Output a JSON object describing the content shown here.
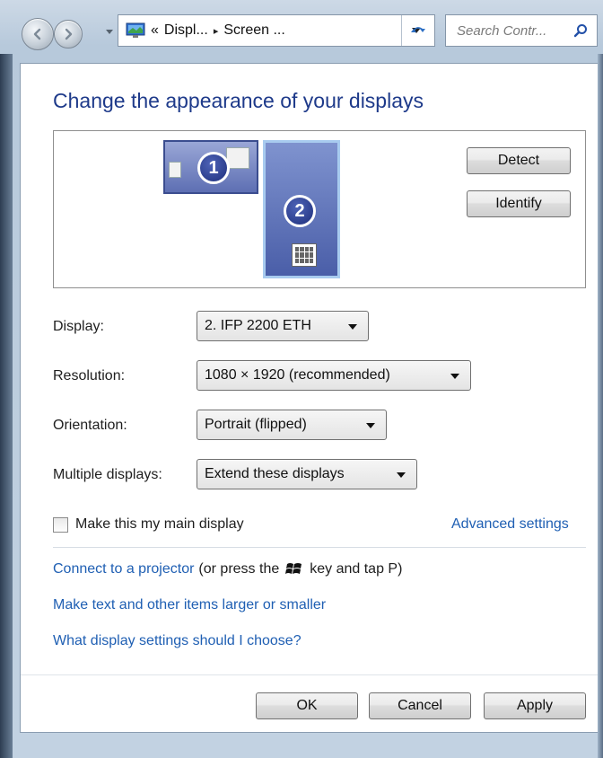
{
  "navbar": {
    "breadcrumb": {
      "prefix": "«",
      "part1": "Displ...",
      "separator": "▸",
      "part2": "Screen ..."
    },
    "search_placeholder": "Search Contr...",
    "icons": [
      "back-arrow-icon",
      "forward-arrow-icon",
      "history-dropdown-icon",
      "control-panel-icon",
      "refresh-icon",
      "search-icon"
    ]
  },
  "page": {
    "title": "Change the appearance of your displays"
  },
  "preview": {
    "monitor1_number": "1",
    "monitor2_number": "2",
    "detect_label": "Detect",
    "identify_label": "Identify"
  },
  "settings": {
    "display": {
      "label": "Display:",
      "value": "2. IFP 2200 ETH"
    },
    "resolution": {
      "label": "Resolution:",
      "value": "1080 × 1920 (recommended)"
    },
    "orientation": {
      "label": "Orientation:",
      "value": "Portrait (flipped)"
    },
    "multiple": {
      "label": "Multiple displays:",
      "value": "Extend these displays"
    }
  },
  "main_display_checkbox": {
    "label": "Make this my main display",
    "checked": false
  },
  "links": {
    "advanced": "Advanced settings",
    "projector": "Connect to a projector",
    "projector_hint_pre": "(or press the",
    "projector_hint_post": "key and tap P)",
    "text_size": "Make text and other items larger or smaller",
    "choose": "What display settings should I choose?"
  },
  "footer": {
    "ok": "OK",
    "cancel": "Cancel",
    "apply": "Apply"
  },
  "colors": {
    "title": "#1e3a8a",
    "link": "#1f5fb3",
    "monitor_fill": "#5d6fb3",
    "monitor_selected_border": "#a8cbef"
  }
}
